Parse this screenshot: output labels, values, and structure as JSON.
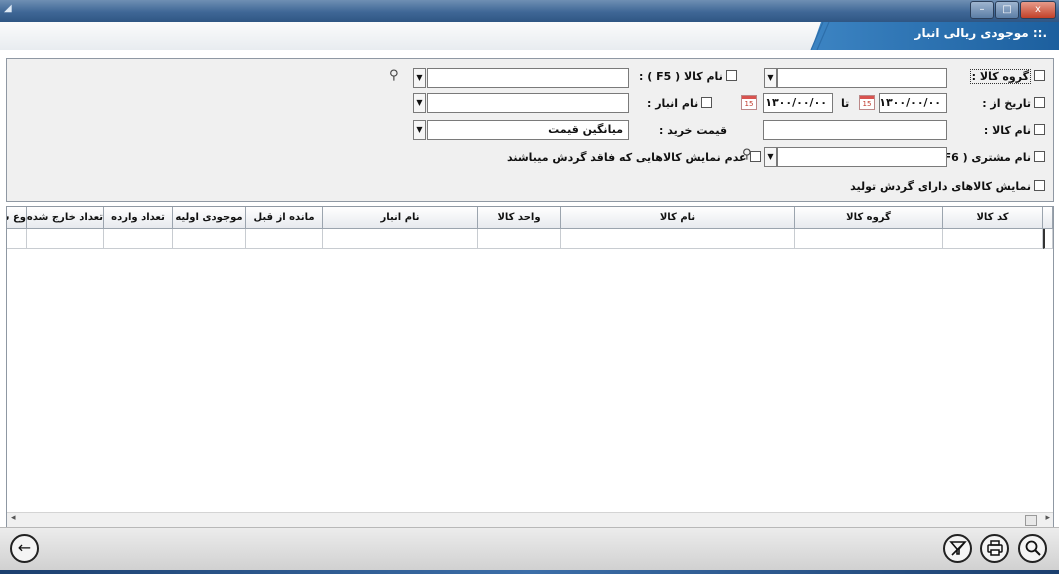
{
  "window": {
    "minimize": "–",
    "maximize": "□",
    "close": "x"
  },
  "header": {
    "title": ".:: موجودی ریالی انبار"
  },
  "filters": {
    "product_group_label": "گروه کالا :",
    "date_from_label": "تاریخ از :",
    "date_from_value": "۱۳۰۰/۰۰/۰۰",
    "date_to_label": "تا",
    "date_to_value": "۱۳۰۰/۰۰/۰۰",
    "product_name_label": "نام کالا :",
    "customer_name_label": "نام مشتری ( F6 ) :",
    "show_production_label": "نمایش کالاهای دارای گردش تولید",
    "product_name_f5_label": "نام کالا ( F5 ) :",
    "warehouse_name_label": "نام انبار :",
    "purchase_price_label": "قیمت خرید :",
    "purchase_price_value": "میانگین قیمت",
    "hide_no_turnover_label": "عدم نمایش کالاهایی که فاقد گردش میباشند",
    "calendar_day": "15"
  },
  "grid": {
    "columns": [
      {
        "label": "کد کالا"
      },
      {
        "label": "گروه کالا"
      },
      {
        "label": "نام کالا"
      },
      {
        "label": "واحد کالا"
      },
      {
        "label": "نام انبار"
      },
      {
        "label": "مانده از قبل"
      },
      {
        "label": "موجودی اولیه"
      },
      {
        "label": "تعداد وارده"
      },
      {
        "label": "تعداد خارج شده"
      },
      {
        "label": "وع ش"
      }
    ]
  },
  "toolbar": {
    "back_glyph": "←"
  }
}
